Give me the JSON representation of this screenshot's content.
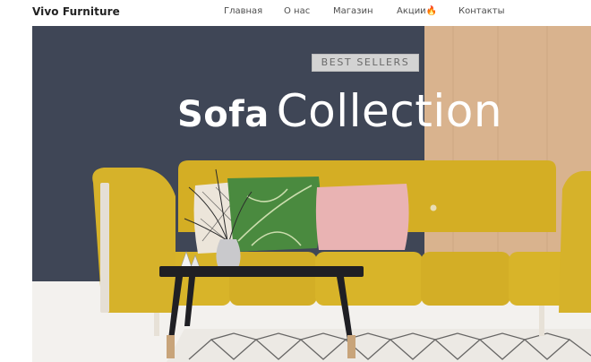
{
  "header": {
    "brand": "Vivo Furniture",
    "nav": [
      {
        "label": "Главная"
      },
      {
        "label": "О нас"
      },
      {
        "label": "Магазин"
      },
      {
        "label": "Акции🔥"
      },
      {
        "label": "Контакты"
      }
    ]
  },
  "hero": {
    "badge": "BEST SELLERS",
    "title_bold": "Sofa",
    "title_light": "Collection"
  },
  "colors": {
    "wall": "#3f4656",
    "wood": "#d9b38e",
    "sofa": "#d8b429",
    "pillow_pink": "#e9b3b3",
    "table": "#1f1f24"
  }
}
